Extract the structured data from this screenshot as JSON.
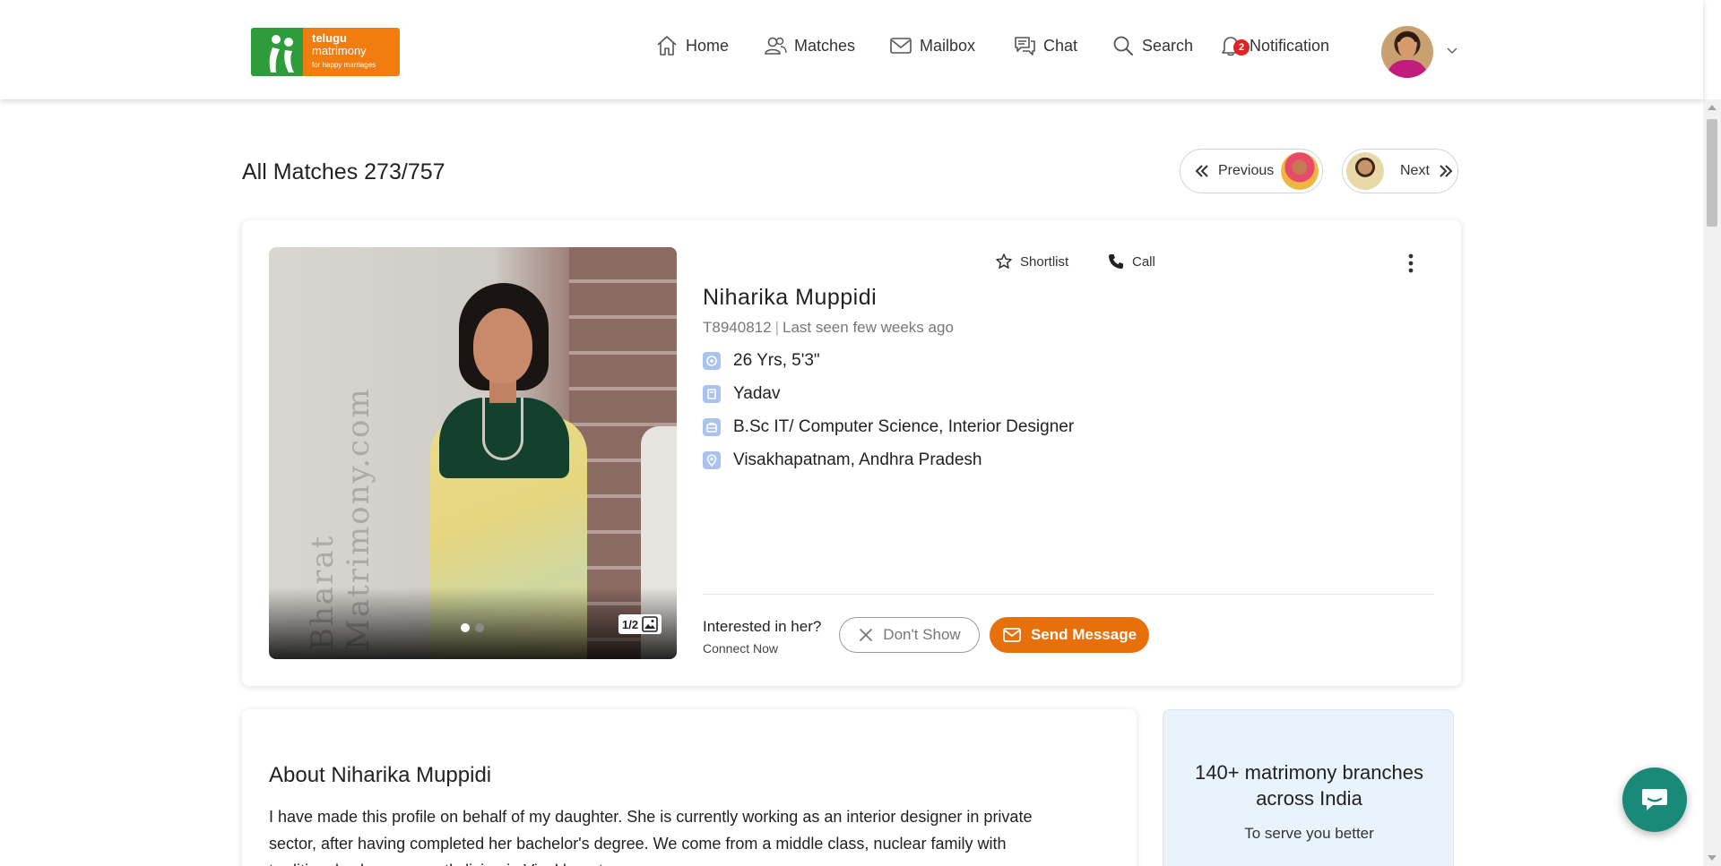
{
  "brand": {
    "line1": "telugu",
    "line2": "matrimony",
    "tagline": "for happy marriages"
  },
  "nav": {
    "home": "Home",
    "matches": "Matches",
    "mailbox": "Mailbox",
    "chat": "Chat",
    "search": "Search",
    "notification": "Notification",
    "notification_count": "2"
  },
  "page": {
    "title": "All Matches 273/757",
    "previous_label": "Previous",
    "next_label": "Next"
  },
  "profile": {
    "name": "Niharika Muppidi",
    "id": "T8940812",
    "last_seen": "Last seen few weeks ago",
    "separator": "|",
    "age_height": "26 Yrs, 5'3\"",
    "community": "Yadav",
    "education_job": "B.Sc IT/ Computer Science, Interior Designer",
    "location": "Visakhapatnam, Andhra Pradesh",
    "photo_counter": "1/2",
    "watermark": "Bharat Matrimony.com",
    "shortlist_label": "Shortlist",
    "call_label": "Call",
    "interest_question": "Interested in her?",
    "interest_sub": "Connect Now",
    "dont_show_label": "Don't Show",
    "send_message_label": "Send Message"
  },
  "about": {
    "title": "About Niharika Muppidi",
    "text": "I have made this profile on behalf of my daughter. She is currently working as an interior designer in private sector, after having completed her bachelor's degree. We come from a middle class, nuclear family with traditional values, currently living in Visakhapatnam."
  },
  "branches": {
    "title": "140+ matrimony branches across India",
    "subtitle": "To serve you better"
  },
  "colors": {
    "accent_orange": "#e8700b",
    "brand_green": "#2e9c3b",
    "chat_fab": "#1a8a78",
    "branches_bg": "#e8f3fc"
  }
}
